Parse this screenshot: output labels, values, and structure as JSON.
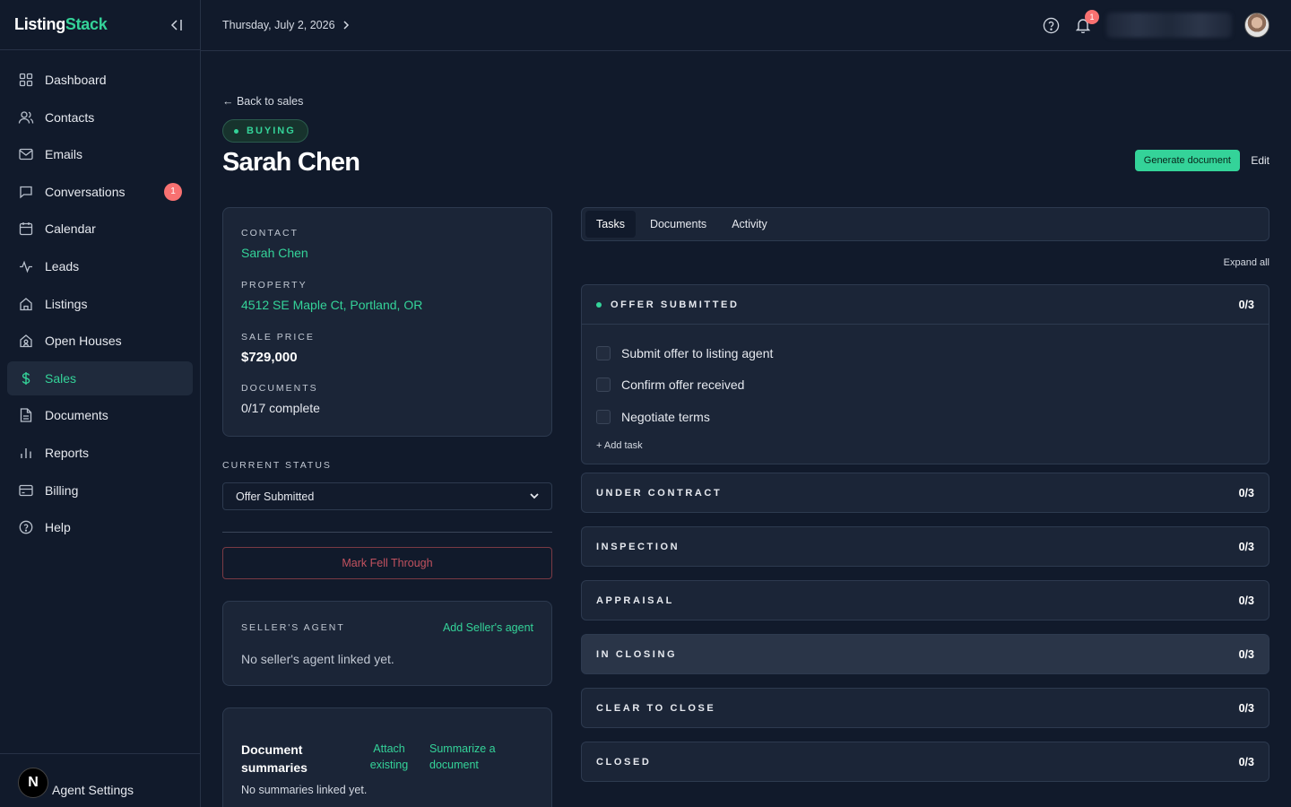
{
  "sidebar": {
    "brand_primary": "Listing",
    "brand_accent": "Stack",
    "items": [
      {
        "label": "Dashboard",
        "icon": "dashboard-icon"
      },
      {
        "label": "Contacts",
        "icon": "users-icon"
      },
      {
        "label": "Emails",
        "icon": "mail-icon"
      },
      {
        "label": "Conversations",
        "icon": "chat-icon",
        "badge": "1"
      },
      {
        "label": "Calendar",
        "icon": "calendar-icon"
      },
      {
        "label": "Leads",
        "icon": "activity-icon"
      },
      {
        "label": "Listings",
        "icon": "home-icon"
      },
      {
        "label": "Open Houses",
        "icon": "open-house-icon"
      },
      {
        "label": "Sales",
        "icon": "dollar-icon",
        "active": true
      },
      {
        "label": "Documents",
        "icon": "document-icon"
      },
      {
        "label": "Reports",
        "icon": "bar-chart-icon"
      },
      {
        "label": "Billing",
        "icon": "credit-card-icon"
      },
      {
        "label": "Help",
        "icon": "help-circle-icon"
      }
    ],
    "footer": {
      "avatar_letter": "N",
      "label": "Agent Settings"
    }
  },
  "header": {
    "date": "Thursday, July 2, 2026",
    "notification_count": "1"
  },
  "page": {
    "back_label": "← Back to sales",
    "pill": "BUYING",
    "title": "Sarah Chen",
    "generate_label": "Generate document",
    "edit_label": "Edit"
  },
  "info": {
    "contact_label": "CONTACT",
    "contact_value": "Sarah Chen",
    "property_label": "PROPERTY",
    "property_value": "4512 SE Maple Ct, Portland, OR",
    "price_label": "SALE PRICE",
    "price_value": "$729,000",
    "documents_label": "DOCUMENTS",
    "documents_value": "0/17 complete"
  },
  "status": {
    "label": "CURRENT STATUS",
    "selected": "Offer Submitted",
    "fell_through_label": "Mark Fell Through"
  },
  "sellers_agent": {
    "label": "SELLER'S AGENT",
    "add_label": "Add Seller's agent",
    "empty": "No seller's agent linked yet."
  },
  "doc_summaries": {
    "title": "Document summaries",
    "attach_label": "Attach existing",
    "summarize_label": "Summarize a document",
    "empty": "No summaries linked yet."
  },
  "tabs": [
    {
      "label": "Tasks",
      "active": true
    },
    {
      "label": "Documents"
    },
    {
      "label": "Activity"
    }
  ],
  "expand_all": "Expand all",
  "stages": [
    {
      "name": "OFFER SUBMITTED",
      "count": "0/3",
      "expanded": true,
      "tasks": [
        "Submit offer to listing agent",
        "Confirm offer received",
        "Negotiate terms"
      ],
      "add_task": "+ Add task"
    },
    {
      "name": "UNDER CONTRACT",
      "count": "0/3"
    },
    {
      "name": "INSPECTION",
      "count": "0/3"
    },
    {
      "name": "APPRAISAL",
      "count": "0/3"
    },
    {
      "name": "IN CLOSING",
      "count": "0/3"
    },
    {
      "name": "CLEAR TO CLOSE",
      "count": "0/3"
    },
    {
      "name": "CLOSED",
      "count": "0/3"
    }
  ],
  "colors": {
    "accent": "#34d399",
    "danger": "#f87171",
    "background": "#111a2b",
    "card": "#1b2537"
  }
}
